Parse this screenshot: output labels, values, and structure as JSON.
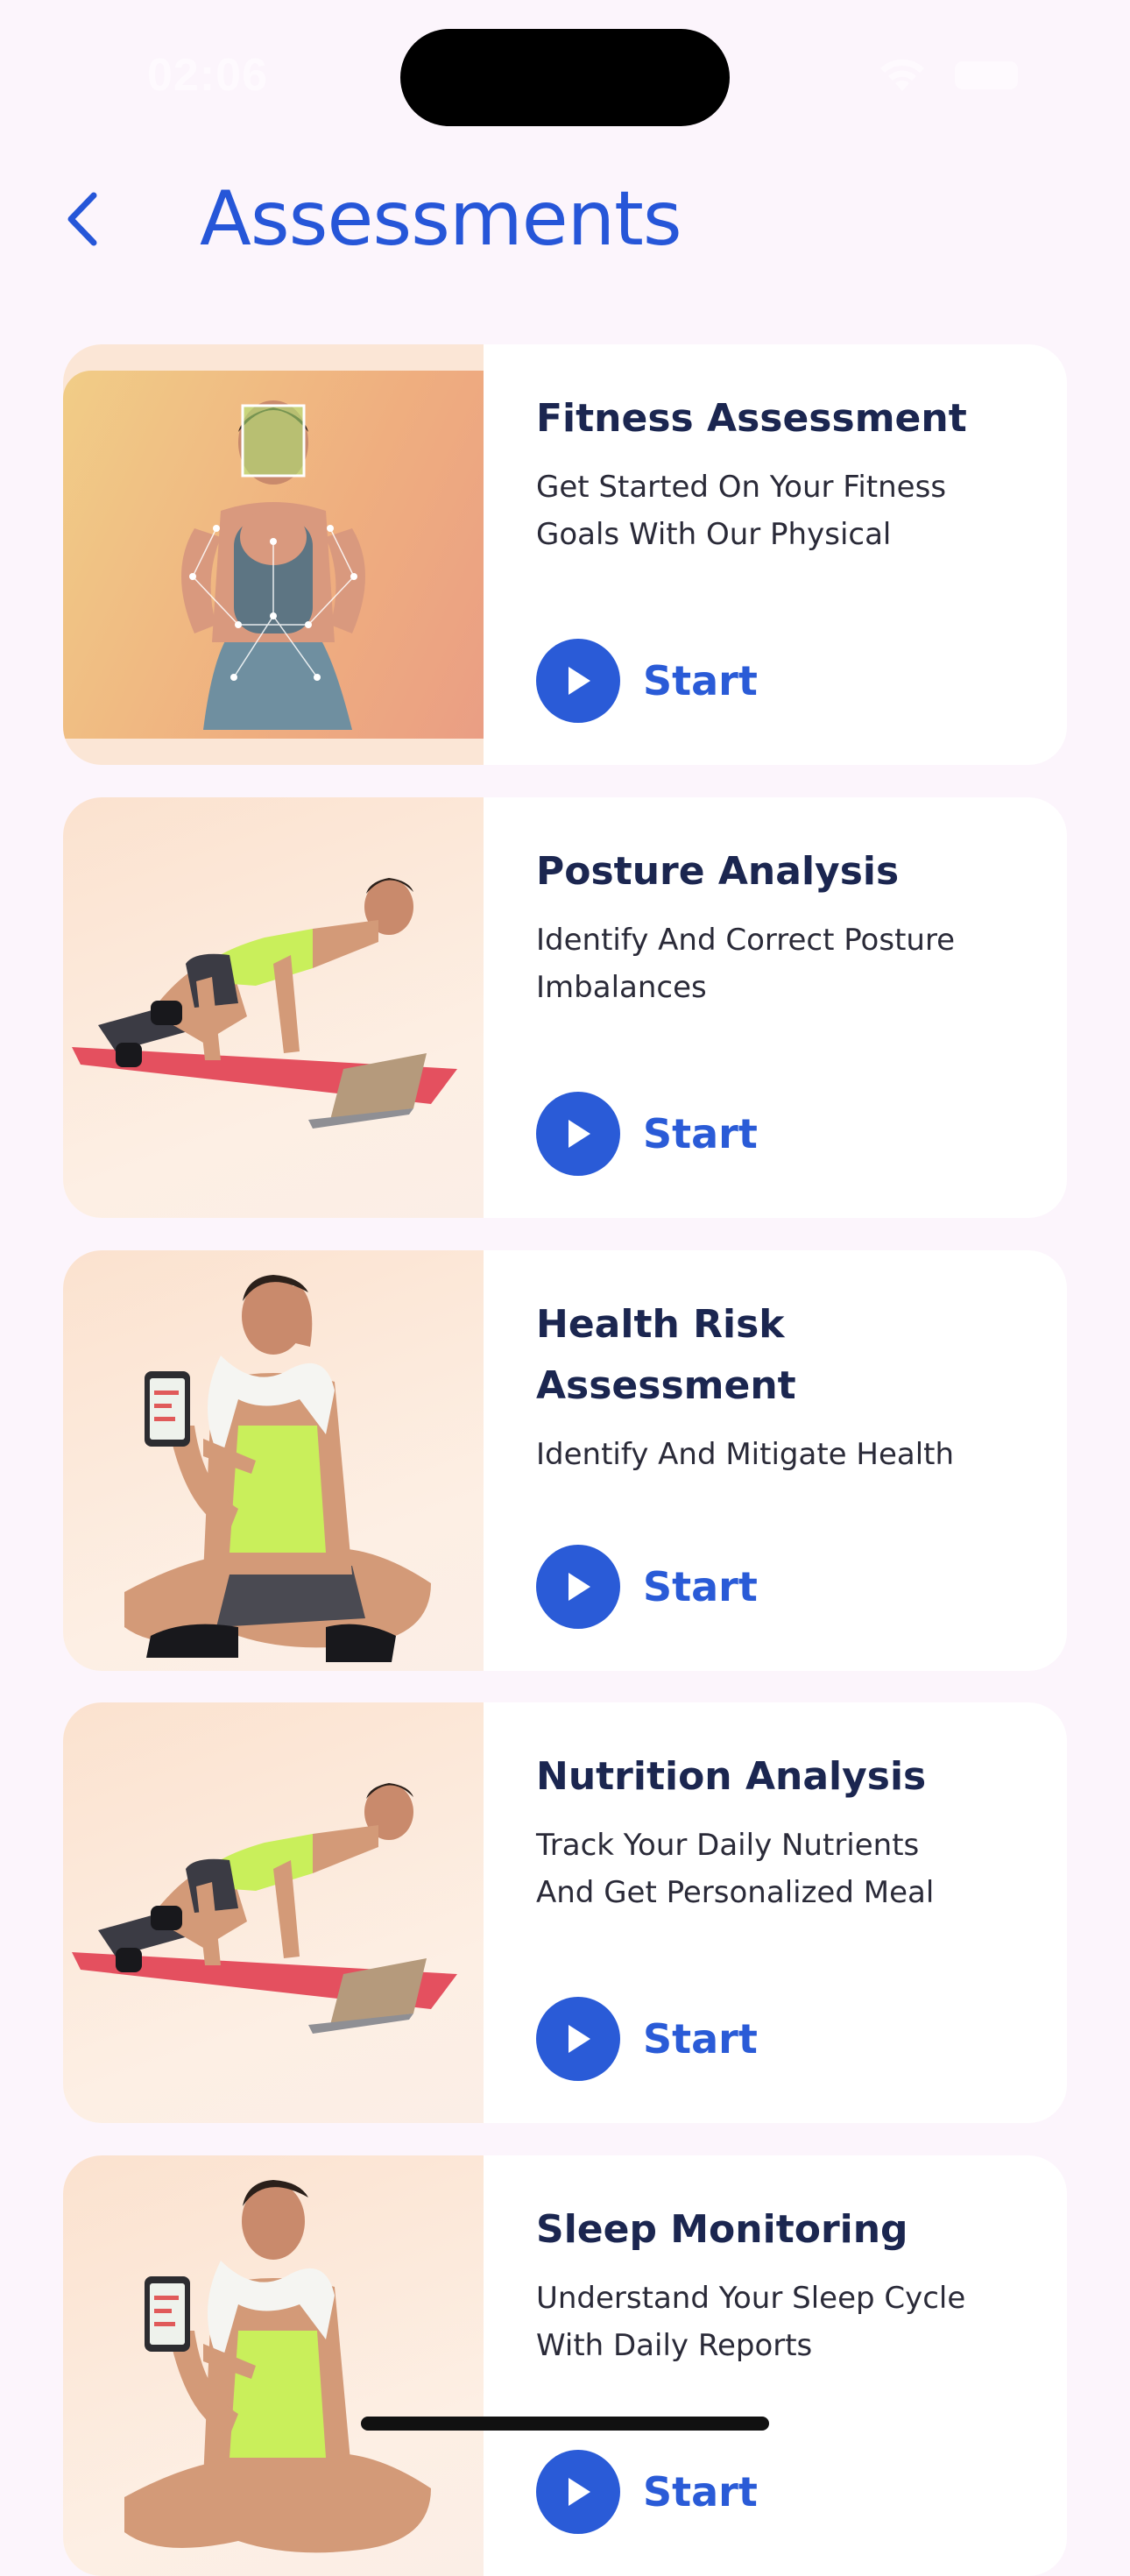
{
  "status_bar": {
    "time": "02:06"
  },
  "header": {
    "title": "Assessments"
  },
  "cards": [
    {
      "title": "Fitness Assessment",
      "description": "Get Started On Your Fitness\nGoals With Our Physical",
      "start_label": "Start"
    },
    {
      "title": "Posture Analysis",
      "description": "Identify And Correct Posture\nImbalances",
      "start_label": "Start"
    },
    {
      "title": "Health Risk Assessment",
      "description": "Identify And Mitigate Health",
      "start_label": "Start"
    },
    {
      "title": "Nutrition Analysis",
      "description": "Track Your Daily Nutrients\nAnd Get Personalized Meal",
      "start_label": "Start"
    },
    {
      "title": "Sleep Monitoring",
      "description": "Understand Your Sleep Cycle\nWith Daily Reports",
      "start_label": "Start"
    }
  ],
  "colors": {
    "accent": "#2a5bd7",
    "title_text": "#1b2650",
    "background": "#fcf5fc"
  },
  "icons": [
    "back-chevron-icon",
    "wifi-icon",
    "battery-icon",
    "play-icon"
  ]
}
